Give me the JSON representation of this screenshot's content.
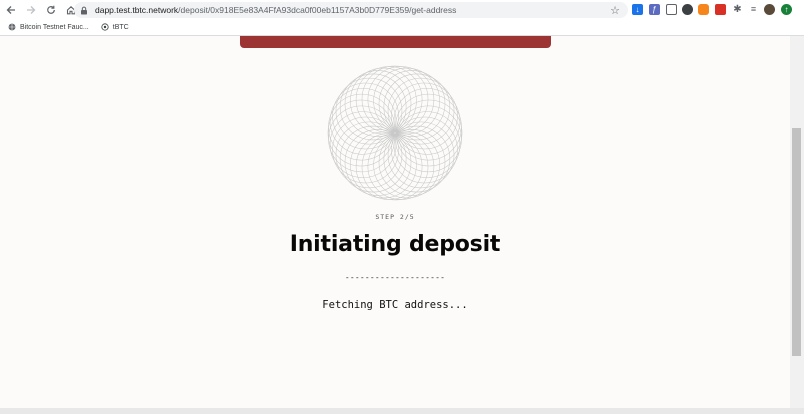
{
  "browser": {
    "url_host": "dapp.test.tbtc.network",
    "url_path": "/deposit/0x918E5e83A4FfA93dca0f00eb1157A3b0D779E359/get-address",
    "bookmarks": [
      {
        "label": "Bitcoin Testnet Fauc..."
      },
      {
        "label": "tBTC"
      }
    ]
  },
  "page": {
    "step_label": "STEP 2/5",
    "title": "Initiating deposit",
    "divider": "--------------------",
    "status": "Fetching BTC address...",
    "banner_color": "#9d3434"
  },
  "icons": [
    "back-arrow-icon",
    "forward-arrow-icon",
    "reload-icon",
    "home-icon",
    "lock-icon",
    "star-icon",
    "extensions-icon",
    "profile-avatar-icon"
  ]
}
